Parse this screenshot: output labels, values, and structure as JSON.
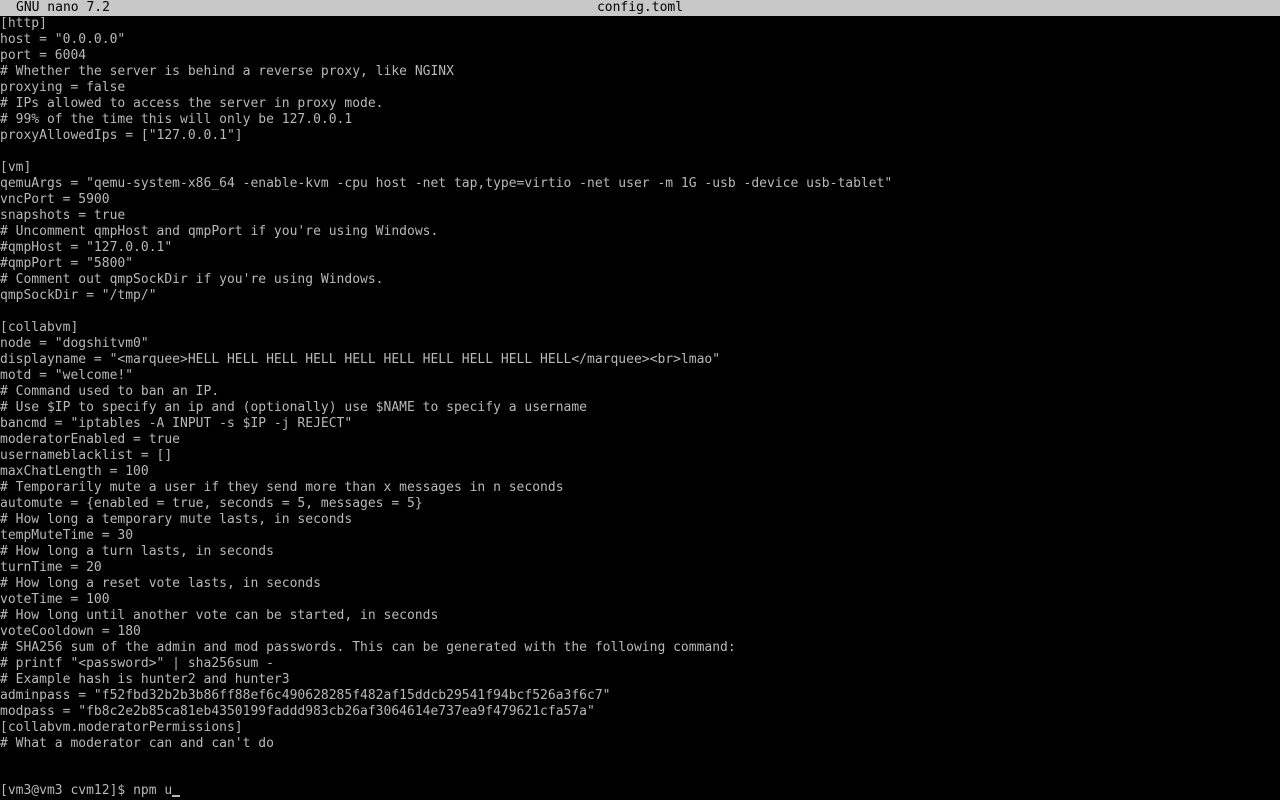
{
  "titlebar": {
    "app": "GNU nano 7.2",
    "filename": "config.toml"
  },
  "lines": [
    "[http]",
    "host = \"0.0.0.0\"",
    "port = 6004",
    "# Whether the server is behind a reverse proxy, like NGINX",
    "proxying = false",
    "# IPs allowed to access the server in proxy mode.",
    "# 99% of the time this will only be 127.0.0.1",
    "proxyAllowedIps = [\"127.0.0.1\"]",
    "",
    "[vm]",
    "qemuArgs = \"qemu-system-x86_64 -enable-kvm -cpu host -net tap,type=virtio -net user -m 1G -usb -device usb-tablet\"",
    "vncPort = 5900",
    "snapshots = true",
    "# Uncomment qmpHost and qmpPort if you're using Windows.",
    "#qmpHost = \"127.0.0.1\"",
    "#qmpPort = \"5800\"",
    "# Comment out qmpSockDir if you're using Windows.",
    "qmpSockDir = \"/tmp/\"",
    "",
    "[collabvm]",
    "node = \"dogshitvm0\"",
    "displayname = \"<marquee>HELL HELL HELL HELL HELL HELL HELL HELL HELL HELL</marquee><br>lmao\"",
    "motd = \"welcome!\"",
    "# Command used to ban an IP.",
    "# Use $IP to specify an ip and (optionally) use $NAME to specify a username",
    "bancmd = \"iptables -A INPUT -s $IP -j REJECT\"",
    "moderatorEnabled = true",
    "usernameblacklist = []",
    "maxChatLength = 100",
    "# Temporarily mute a user if they send more than x messages in n seconds",
    "automute = {enabled = true, seconds = 5, messages = 5}",
    "# How long a temporary mute lasts, in seconds",
    "tempMuteTime = 30",
    "# How long a turn lasts, in seconds",
    "turnTime = 20",
    "# How long a reset vote lasts, in seconds",
    "voteTime = 100",
    "# How long until another vote can be started, in seconds",
    "voteCooldown = 180",
    "# SHA256 sum of the admin and mod passwords. This can be generated with the following command:",
    "# printf \"<password>\" | sha256sum -",
    "# Example hash is hunter2 and hunter3",
    "adminpass = \"f52fbd32b2b3b86ff88ef6c490628285f482af15ddcb29541f94bcf526a3f6c7\"",
    "modpass = \"fb8c2e2b85ca81eb4350199faddd983cb26af3064614e737ea9f479621cfa57a\"",
    "[collabvm.moderatorPermissions]",
    "# What a moderator can and can't do"
  ],
  "shell": {
    "prompt": "[vm3@vm3 cvm12]$ ",
    "command": "npm u"
  },
  "colors": {
    "background": "#000000",
    "text": "#b8b8b8",
    "titlebar_bg": "#c8c8c8",
    "titlebar_fg": "#000000"
  }
}
